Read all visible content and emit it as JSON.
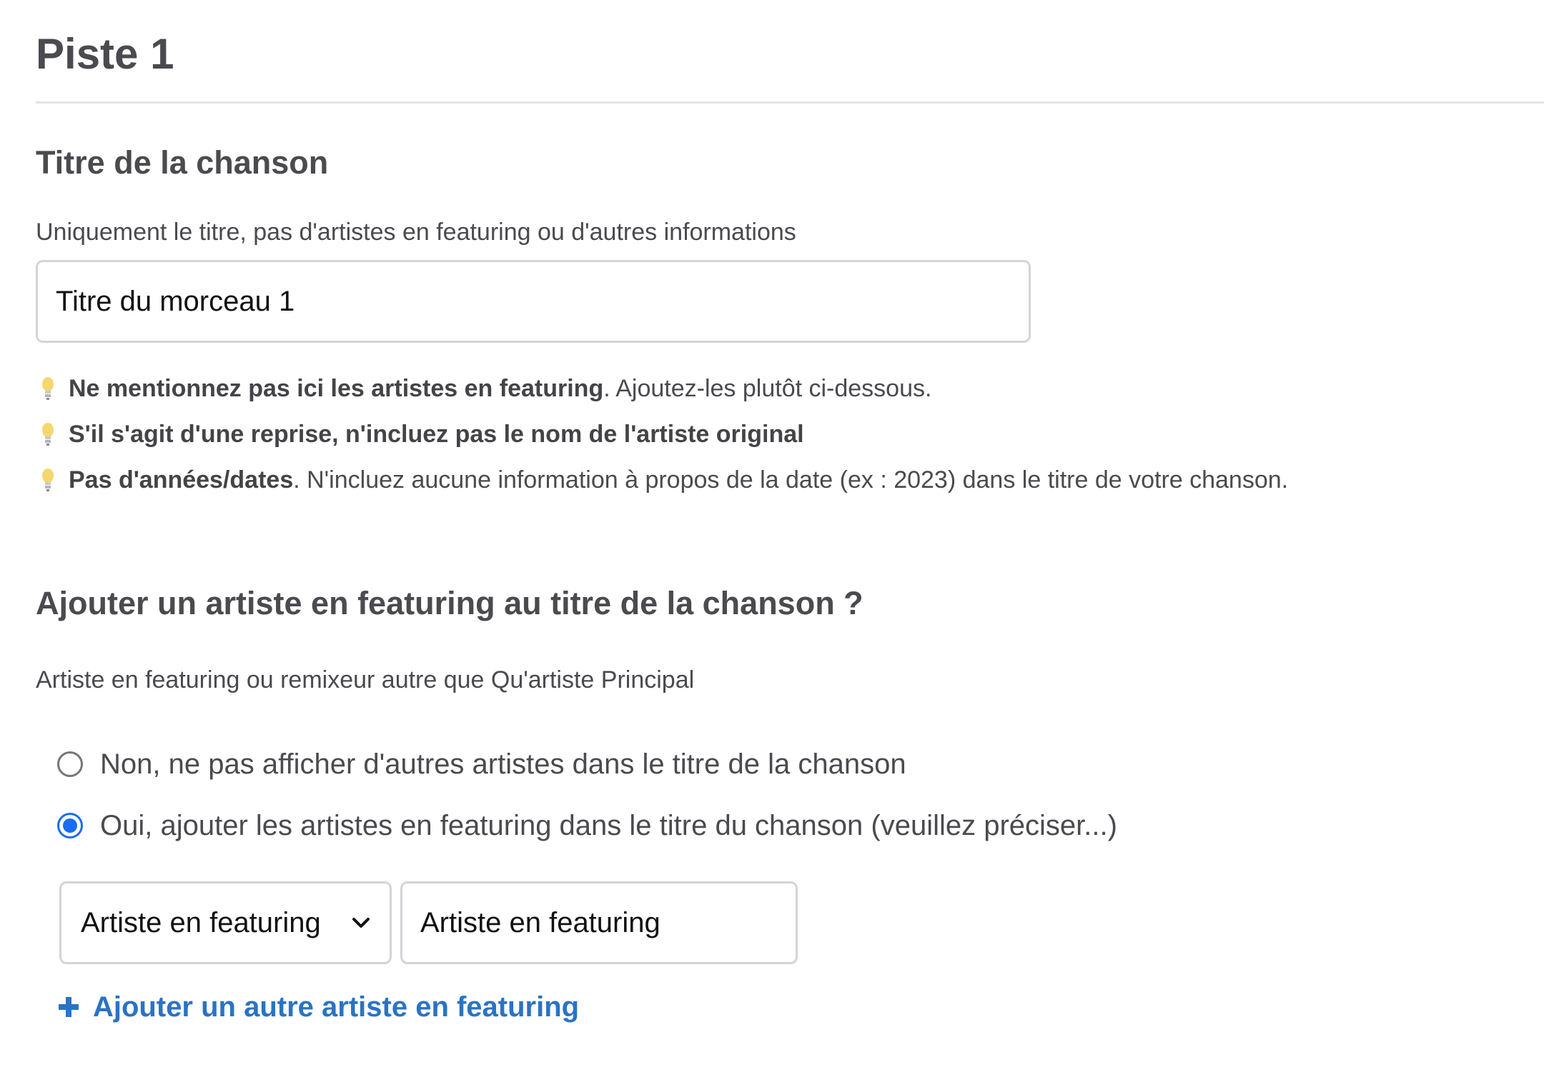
{
  "page": {
    "title": "Piste 1"
  },
  "song_title_section": {
    "heading": "Titre de la chanson",
    "help": "Uniquement le titre, pas d'artistes en featuring ou d'autres informations",
    "input_value": "Titre du morceau 1",
    "tips": [
      {
        "icon": "lightbulb-icon",
        "strong": "Ne mentionnez pas ici les artistes en featuring",
        "rest": ". Ajoutez-les plutôt ci-dessous."
      },
      {
        "icon": "lightbulb-icon",
        "strong": "S'il s'agit d'une reprise, n'incluez pas le nom de l'artiste original",
        "rest": ""
      },
      {
        "icon": "lightbulb-icon",
        "strong": "Pas d'années/dates",
        "rest": ". N'incluez aucune information à propos de la date (ex : 2023) dans le titre de votre chanson."
      }
    ]
  },
  "featuring_section": {
    "heading": "Ajouter un artiste en featuring au titre de la chanson ?",
    "help": "Artiste en featuring ou remixeur autre que Qu'artiste Principal",
    "options": [
      {
        "label": "Non, ne pas afficher d'autres artistes dans le titre de la chanson",
        "checked": false
      },
      {
        "label": "Oui, ajouter les artistes en featuring dans le titre du chanson (veuillez préciser...)",
        "checked": true
      }
    ],
    "role_select": {
      "selected": "Artiste en featuring",
      "icon": "chevron-down-icon"
    },
    "artist_input_value": "Artiste en featuring",
    "add_link": {
      "icon": "plus-icon",
      "label": "Ajouter un autre artiste en featuring"
    }
  },
  "colors": {
    "text": "#4a4a4f",
    "border": "#d4d4d8",
    "accent_radio": "#1a6cf0",
    "link": "#2a73c4",
    "bulb": "#f5d76e"
  }
}
